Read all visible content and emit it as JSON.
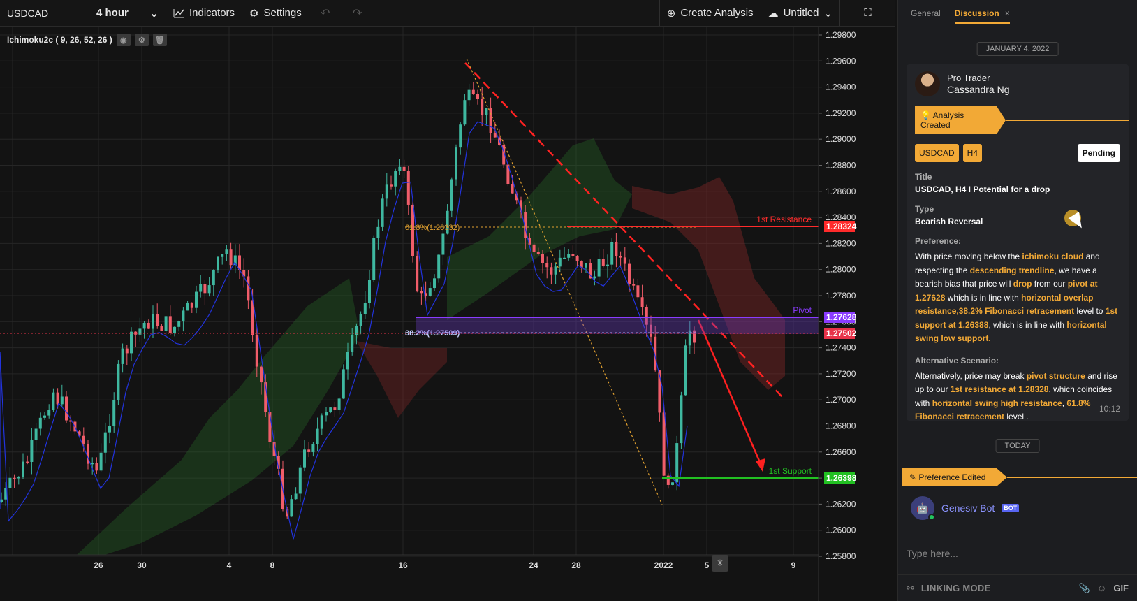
{
  "toolbar": {
    "symbol": "USDCAD",
    "interval": "4 hour",
    "indicators_label": "Indicators",
    "settings_label": "Settings",
    "create_analysis_label": "Create Analysis",
    "project_label": "Untitled"
  },
  "chart": {
    "indicator_label": "Ichimoku2c ( 9, 26, 52, 26 )",
    "price_ticks": [
      "1.29800",
      "1.29600",
      "1.29400",
      "1.29200",
      "1.29000",
      "1.28800",
      "1.28600",
      "1.28400",
      "1.28200",
      "1.28000",
      "1.27800",
      "1.27600",
      "1.27400",
      "1.27200",
      "1.27000",
      "1.26800",
      "1.26600",
      "1.26400",
      "1.26200",
      "1.26000",
      "1.25800"
    ],
    "date_ticks": [
      "26",
      "30",
      "4",
      "8",
      "16",
      "24",
      "28",
      "2022",
      "5",
      "9"
    ],
    "levels": {
      "resistance": {
        "label": "1st Resistance",
        "price": "1.28324",
        "color": "#ff2b2b"
      },
      "pivot": {
        "label": "Pivot",
        "price": "1.27628",
        "color": "#8a3cff"
      },
      "current": {
        "price": "1.27502",
        "color": "#e8334a"
      },
      "support": {
        "label": "1st Support",
        "price": "1.26398",
        "color": "#22c022"
      }
    },
    "fib_labels": {
      "f618": "61.8%(1.28332)",
      "f382": "38.2%(1.27509)"
    }
  },
  "panel": {
    "tab_general": "General",
    "tab_discussion": "Discussion",
    "tab_close": "×",
    "date_label": "JANUARY 4, 2022",
    "author_role": "Pro Trader",
    "author_name": "Cassandra Ng",
    "ribbon_created": "Analysis Created",
    "tag_symbol": "USDCAD",
    "tag_interval": "H4",
    "status": "Pending",
    "title_label": "Title",
    "title_value": "USDCAD, H4 I Potential for a drop",
    "type_label": "Type",
    "type_value": "Bearish Reversal",
    "preference_label": "Preference:",
    "alt_label": "Alternative Scenario:",
    "message_time": "10:12",
    "today_label": "TODAY",
    "ribbon_edited": "Preference Edited",
    "bot_name": "Genesiv Bot",
    "bot_badge": "BOT",
    "input_placeholder": "Type here...",
    "linking_mode": "LINKING MODE",
    "gif_label": "GIF"
  },
  "preference_parts": [
    {
      "t": "With price moving below the ",
      "h": false
    },
    {
      "t": "ichimoku cloud",
      "h": true
    },
    {
      "t": " and respecting the ",
      "h": false
    },
    {
      "t": "descending trendline",
      "h": true
    },
    {
      "t": ", we have a bearish bias that price will ",
      "h": false
    },
    {
      "t": "drop",
      "h": true
    },
    {
      "t": " from our ",
      "h": false
    },
    {
      "t": "pivot at 1.27628",
      "h": true
    },
    {
      "t": " which is in line with ",
      "h": false
    },
    {
      "t": "horizontal overlap resistance,38.2% Fibonacci retracement",
      "h": true
    },
    {
      "t": " level to ",
      "h": false
    },
    {
      "t": "1st  support at 1.26388",
      "h": true
    },
    {
      "t": ", which is in line with ",
      "h": false
    },
    {
      "t": "horizontal swing low support.",
      "h": true
    }
  ],
  "alternative_parts": [
    {
      "t": " Alternatively, price may break ",
      "h": false
    },
    {
      "t": "pivot structure",
      "h": true
    },
    {
      "t": " and rise up to our ",
      "h": false
    },
    {
      "t": "1st resistance at 1.28328",
      "h": true
    },
    {
      "t": ", which coincides with ",
      "h": false
    },
    {
      "t": "horizontal swing high resistance",
      "h": true
    },
    {
      "t": ", ",
      "h": false
    },
    {
      "t": "61.8% Fibonacci retracement",
      "h": true
    },
    {
      "t": " level .",
      "h": false
    }
  ]
}
